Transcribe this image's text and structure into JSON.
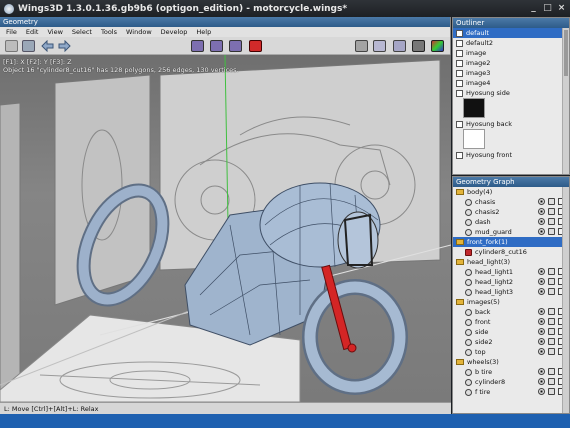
{
  "window": {
    "title": "Wings3D 1.3.0.1.36.gb9b6 (optigon_edition) - motorcycle.wings*",
    "buttons": [
      "_",
      "□",
      "×"
    ]
  },
  "geometry": {
    "title": "Geometry",
    "menu": [
      "File",
      "Edit",
      "View",
      "Select",
      "Tools",
      "Window",
      "Develop",
      "Help"
    ],
    "info_line1": "[F1]: X  [F2]: Y  [F3]: Z",
    "info_line2": "Object 16 \"cylinder8_cut16\" has 128 polygons, 256 edges, 130 vertices.",
    "status": "L: Move  [Ctrl]+[Alt]+L: Relax"
  },
  "outliner": {
    "title": "Outliner",
    "items": [
      {
        "label": "default",
        "selected": true
      },
      {
        "label": "default2"
      },
      {
        "label": "image"
      },
      {
        "label": "image2"
      },
      {
        "label": "image3"
      },
      {
        "label": "image4"
      },
      {
        "label": "Hyosung side"
      },
      {
        "label": "Hyosung back"
      },
      {
        "label": "Hyosung front"
      }
    ]
  },
  "graph": {
    "title": "Geometry Graph",
    "rows": [
      {
        "type": "folder",
        "label": "body(4)"
      },
      {
        "type": "obj",
        "label": "chasis"
      },
      {
        "type": "obj",
        "label": "chasis2"
      },
      {
        "type": "obj",
        "label": "dash"
      },
      {
        "type": "obj",
        "label": "mud_guard"
      },
      {
        "type": "folder",
        "label": "front_fork(1)",
        "selected": true
      },
      {
        "type": "obj",
        "label": "cylinder8_cut16",
        "red": true
      },
      {
        "type": "folder",
        "label": "head_light(3)"
      },
      {
        "type": "obj",
        "label": "head_light1"
      },
      {
        "type": "obj",
        "label": "head_light2"
      },
      {
        "type": "obj",
        "label": "head_light3"
      },
      {
        "type": "folder",
        "label": "images(5)"
      },
      {
        "type": "obj",
        "label": "back"
      },
      {
        "type": "obj",
        "label": "front"
      },
      {
        "type": "obj",
        "label": "side"
      },
      {
        "type": "obj",
        "label": "side2"
      },
      {
        "type": "obj",
        "label": "top"
      },
      {
        "type": "folder",
        "label": "wheels(3)"
      },
      {
        "type": "obj",
        "label": "b tire"
      },
      {
        "type": "obj",
        "label": "cylinder8"
      },
      {
        "type": "obj",
        "label": "f tire"
      }
    ]
  },
  "colors": {
    "accent": "#2f6cc4",
    "title_bar": "#2d5b89",
    "selected_red": "#c0282c"
  }
}
